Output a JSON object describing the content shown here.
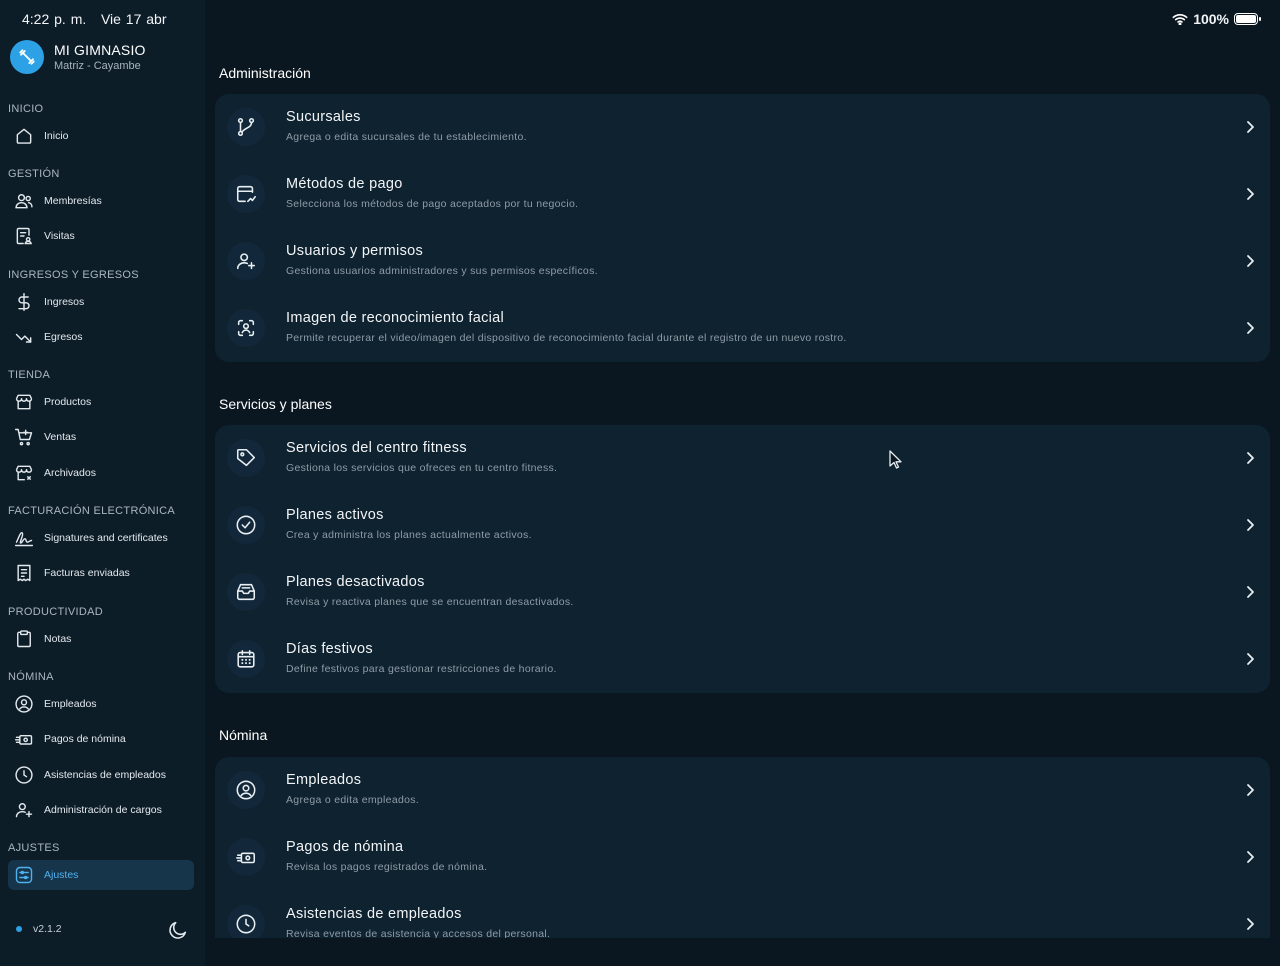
{
  "status": {
    "time": "4:22 p. m.",
    "date": "Vie 17 abr",
    "battery": "100%"
  },
  "brand": {
    "name": "MI GIMNASIO",
    "subtitle": "Matriz - Cayambe"
  },
  "sidebar": {
    "sections": [
      {
        "label": "INICIO",
        "items": [
          {
            "label": "Inicio",
            "icon": "home-icon"
          }
        ]
      },
      {
        "label": "GESTIÓN",
        "items": [
          {
            "label": "Membresías",
            "icon": "users-icon"
          },
          {
            "label": "Visitas",
            "icon": "visit-log-icon"
          }
        ]
      },
      {
        "label": "INGRESOS Y EGRESOS",
        "items": [
          {
            "label": "Ingresos",
            "icon": "dollar-icon"
          },
          {
            "label": "Egresos",
            "icon": "trend-down-icon"
          }
        ]
      },
      {
        "label": "TIENDA",
        "items": [
          {
            "label": "Productos",
            "icon": "store-icon"
          },
          {
            "label": "Ventas",
            "icon": "cart-icon"
          },
          {
            "label": "Archivados",
            "icon": "archive-store-icon"
          }
        ]
      },
      {
        "label": "FACTURACIÓN ELECTRÓNICA",
        "items": [
          {
            "label": "Signatures and certificates",
            "icon": "signature-icon"
          },
          {
            "label": "Facturas enviadas",
            "icon": "receipt-icon"
          }
        ]
      },
      {
        "label": "PRODUCTIVIDAD",
        "items": [
          {
            "label": "Notas",
            "icon": "clipboard-icon"
          }
        ]
      },
      {
        "label": "NÓMINA",
        "items": [
          {
            "label": "Empleados",
            "icon": "user-circle-icon"
          },
          {
            "label": "Pagos de nómina",
            "icon": "cash-icon"
          },
          {
            "label": "Asistencias de empleados",
            "icon": "clock-icon"
          },
          {
            "label": "Administración de cargos",
            "icon": "user-plus-icon"
          }
        ]
      },
      {
        "label": "AJUSTES",
        "items": [
          {
            "label": "Ajustes",
            "icon": "settings-sliders-icon",
            "active": true
          }
        ]
      }
    ],
    "version": "v2.1.2"
  },
  "groups": [
    {
      "title": "Administración",
      "rows": [
        {
          "title": "Sucursales",
          "desc": "Agrega o edita sucursales de tu establecimiento.",
          "icon": "branch-icon"
        },
        {
          "title": "Métodos de pago",
          "desc": "Selecciona los métodos de pago aceptados por tu negocio.",
          "icon": "payment-icon"
        },
        {
          "title": "Usuarios y permisos",
          "desc": "Gestiona usuarios administradores y sus permisos específicos.",
          "icon": "user-plus-icon"
        },
        {
          "title": "Imagen de reconocimiento facial",
          "desc": "Permite recuperar el video/imagen del dispositivo de reconocimiento facial durante el registro de un nuevo rostro.",
          "icon": "face-scan-icon"
        }
      ]
    },
    {
      "title": "Servicios y planes",
      "rows": [
        {
          "title": "Servicios del centro fitness",
          "desc": "Gestiona los servicios que ofreces en tu centro fitness.",
          "icon": "tag-icon"
        },
        {
          "title": "Planes activos",
          "desc": "Crea y administra los planes actualmente activos.",
          "icon": "check-circle-icon"
        },
        {
          "title": "Planes desactivados",
          "desc": "Revisa y reactiva planes que se encuentran desactivados.",
          "icon": "inbox-icon"
        },
        {
          "title": "Días festivos",
          "desc": "Define festivos para gestionar restricciones de horario.",
          "icon": "calendar-icon"
        }
      ]
    },
    {
      "title": "Nómina",
      "rows": [
        {
          "title": "Empleados",
          "desc": "Agrega o edita empleados.",
          "icon": "user-circle-icon"
        },
        {
          "title": "Pagos de nómina",
          "desc": "Revisa los pagos registrados de nómina.",
          "icon": "cash-icon"
        },
        {
          "title": "Asistencias de empleados",
          "desc": "Revisa eventos de asistencia y accesos del personal.",
          "icon": "clock-icon"
        }
      ]
    }
  ],
  "colors": {
    "accent": "#2da1e6",
    "background": "#0b1720",
    "sidebar": "#0d1d28",
    "card": "#0f2230"
  }
}
